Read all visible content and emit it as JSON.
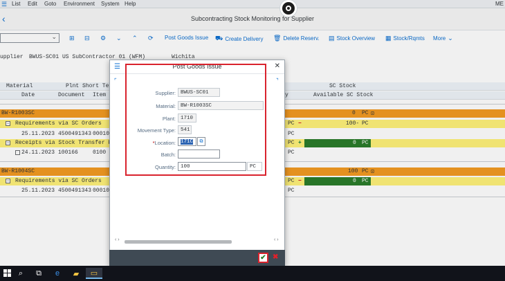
{
  "menubar": {
    "items": [
      "List",
      "Edit",
      "Goto",
      "Environment",
      "System",
      "Help"
    ],
    "right_text": "ME"
  },
  "titlebar": {
    "title": "Subcontracting Stock Monitoring for Supplier"
  },
  "toolbar": {
    "post_goods_issue": "Post Goods Issue",
    "create_delivery": "Create Delivery",
    "delete_reserv": "Delete Reserv.",
    "stock_overview": "Stock Overview",
    "stock_rqmts": "Stock/Rqmts",
    "more": "More"
  },
  "header_info": {
    "label": "upplier",
    "supplier_id": "BWUS-SC01",
    "supplier_name": "US SubContractor 01 (WFM)",
    "city": "Wichita"
  },
  "grid": {
    "header1": {
      "material": "Material",
      "plant_short_text": "Plnt Short Text",
      "sc_stock": "SC Stock"
    },
    "header2": {
      "date": "Date",
      "document": "Document",
      "item": "Item",
      "y_col": "y",
      "available_sc_stock": "Available SC Stock"
    },
    "group1": {
      "material": "BW-R1003SC",
      "qty": "0",
      "unit": "PC",
      "req_label": "Requirements via SC Orders",
      "req_unit": "PC",
      "req_qty": "100-",
      "req_qty_unit": "PC",
      "req_date": "25.11.2023",
      "req_doc": "4500491343",
      "req_item": "00010",
      "req_detail_unit": "PC",
      "rec_label": "Receipts via Stock Transfer Re",
      "rec_unit": "PC",
      "rec_qty": "0",
      "rec_qty_unit": "PC",
      "rec_date": "24.11.2023",
      "rec_doc": "100166",
      "rec_item": "0100",
      "rec_detail_unit": "PC"
    },
    "group2": {
      "material": "BW-R1004SC",
      "qty": "100",
      "unit": "PC",
      "req_label": "Requirements via SC Orders",
      "req_unit": "PC",
      "req_qty": "0",
      "req_qty_unit": "PC",
      "req_date": "25.11.2023",
      "req_doc": "4500491343",
      "req_item": "00010",
      "req_detail_unit": "PC"
    }
  },
  "dialog": {
    "title": "Post Goods Issue",
    "fields": {
      "supplier_label": "Supplier:",
      "supplier_value": "BWUS-SC01",
      "material_label": "Material:",
      "material_value": "BW-R1003SC",
      "plant_label": "Plant:",
      "plant_value": "1710",
      "movement_type_label": "Movement Type:",
      "movement_type_value": "541",
      "location_label": "Location:",
      "location_value": "171C",
      "batch_label": "Batch:",
      "batch_value": "",
      "quantity_label": "Quantity:",
      "quantity_value": "100",
      "quantity_unit": "PC"
    }
  },
  "colors": {
    "group_row": "#f39b22",
    "sub_row": "#fff27a",
    "available_ok": "#2b7d2b",
    "highlight_border": "#d9232d",
    "sap_blue": "#0a6ed1"
  }
}
